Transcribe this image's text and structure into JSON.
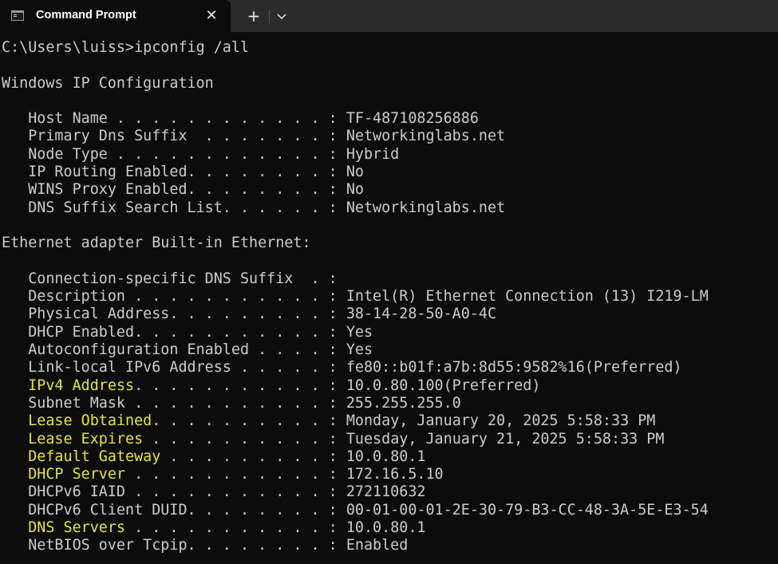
{
  "window": {
    "tab_title": "Command Prompt",
    "close_glyph": "✕",
    "new_tab_glyph": "+",
    "icons": {
      "tab": "command-prompt-icon",
      "close": "close-icon",
      "new_tab": "plus-icon",
      "dropdown": "chevron-down-icon"
    }
  },
  "colors": {
    "background": "#0c0c0c",
    "titlebar": "#2b2b2b",
    "text": "#cccccc",
    "highlight": "#e5e53a"
  },
  "terminal": {
    "lines": [
      {
        "text": "C:\\Users\\luiss>ipconfig /all"
      },
      {
        "text": ""
      },
      {
        "text": "Windows IP Configuration"
      },
      {
        "text": ""
      },
      {
        "label": "   Host Name . . . . . . . . . . . . ",
        "value": ": TF-487108256886"
      },
      {
        "label": "   Primary Dns Suffix  . . . . . . . ",
        "value": ": Networkinglabs.net"
      },
      {
        "label": "   Node Type . . . . . . . . . . . . ",
        "value": ": Hybrid"
      },
      {
        "label": "   IP Routing Enabled. . . . . . . . ",
        "value": ": No"
      },
      {
        "label": "   WINS Proxy Enabled. . . . . . . . ",
        "value": ": No"
      },
      {
        "label": "   DNS Suffix Search List. . . . . . ",
        "value": ": Networkinglabs.net"
      },
      {
        "text": ""
      },
      {
        "text": "Ethernet adapter Built-in Ethernet:"
      },
      {
        "text": ""
      },
      {
        "label": "   Connection-specific DNS Suffix  . ",
        "value": ":"
      },
      {
        "label": "   Description . . . . . . . . . . . ",
        "value": ": Intel(R) Ethernet Connection (13) I219-LM"
      },
      {
        "label": "   Physical Address. . . . . . . . . ",
        "value": ": 38-14-28-50-A0-4C"
      },
      {
        "label": "   DHCP Enabled. . . . . . . . . . . ",
        "value": ": Yes"
      },
      {
        "label": "   Autoconfiguration Enabled . . . . ",
        "value": ": Yes"
      },
      {
        "label": "   Link-local IPv6 Address . . . . . ",
        "value": ": fe80::b01f:a7b:8d55:9582%16(Preferred)"
      },
      {
        "indent": "   ",
        "hl": "IPv4 Address.",
        "label": " . . . . . . . . . . ",
        "value": ": 10.0.80.100(Preferred)"
      },
      {
        "label": "   Subnet Mask . . . . . . . . . . . ",
        "value": ": 255.255.255.0"
      },
      {
        "indent": "   ",
        "hl": "Lease Obtained.",
        "label": " . . . . . . . . . ",
        "value": ": Monday, January 20, 2025 5:58:33 PM"
      },
      {
        "indent": "   ",
        "hl": "Lease Expires .",
        "label": " . . . . . . . . . ",
        "value": ": Tuesday, January 21, 2025 5:58:33 PM"
      },
      {
        "indent": "   ",
        "hl": "Default Gateway",
        "label": " . . . . . . . . . ",
        "value": ": 10.0.80.1"
      },
      {
        "indent": "   ",
        "hl": "DHCP Server",
        "label": " . . . . . . . . . . . ",
        "value": ": 172.16.5.10"
      },
      {
        "label": "   DHCPv6 IAID . . . . . . . . . . . ",
        "value": ": 272110632"
      },
      {
        "label": "   DHCPv6 Client DUID. . . . . . . . ",
        "value": ": 00-01-00-01-2E-30-79-B3-CC-48-3A-5E-E3-54"
      },
      {
        "indent": "   ",
        "hl": "DNS Servers",
        "label": " . . . . . . . . . . . ",
        "value": ": 10.0.80.1"
      },
      {
        "label": "   NetBIOS over Tcpip. . . . . . . . ",
        "value": ": Enabled"
      }
    ]
  }
}
